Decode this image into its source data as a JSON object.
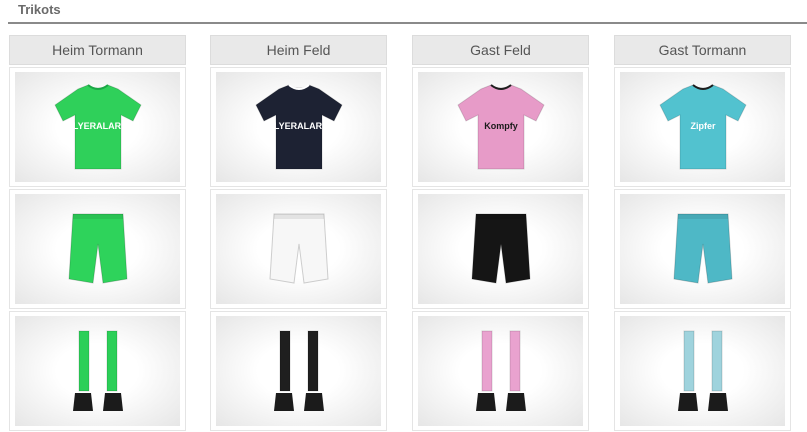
{
  "section": {
    "title": "Trikots"
  },
  "columns": [
    {
      "label": "Heim Tormann",
      "colors": {
        "shirt": "#2fd05a",
        "shirt_trim": "#1aa845",
        "shorts": "#2ed35b",
        "socks": "#2ccf58"
      },
      "sponsor": "FLYERALARM"
    },
    {
      "label": "Heim Feld",
      "colors": {
        "shirt": "#1d2233",
        "shirt_trim": "#ffffff",
        "shorts": "#f7f7f7",
        "socks": "#1f1f1f"
      },
      "sponsor": "FLYERALARM"
    },
    {
      "label": "Gast Feld",
      "colors": {
        "shirt": "#e79bc8",
        "shirt_trim": "#1e1e1e",
        "shorts": "#151515",
        "socks": "#e9a2cf"
      },
      "sponsor": "Kompfy"
    },
    {
      "label": "Gast Tormann",
      "colors": {
        "shirt": "#52c2cf",
        "shirt_trim": "#1e1e1e",
        "shorts": "#4eb8c6",
        "socks": "#9fd3dd"
      },
      "sponsor": "Zipfer"
    }
  ]
}
